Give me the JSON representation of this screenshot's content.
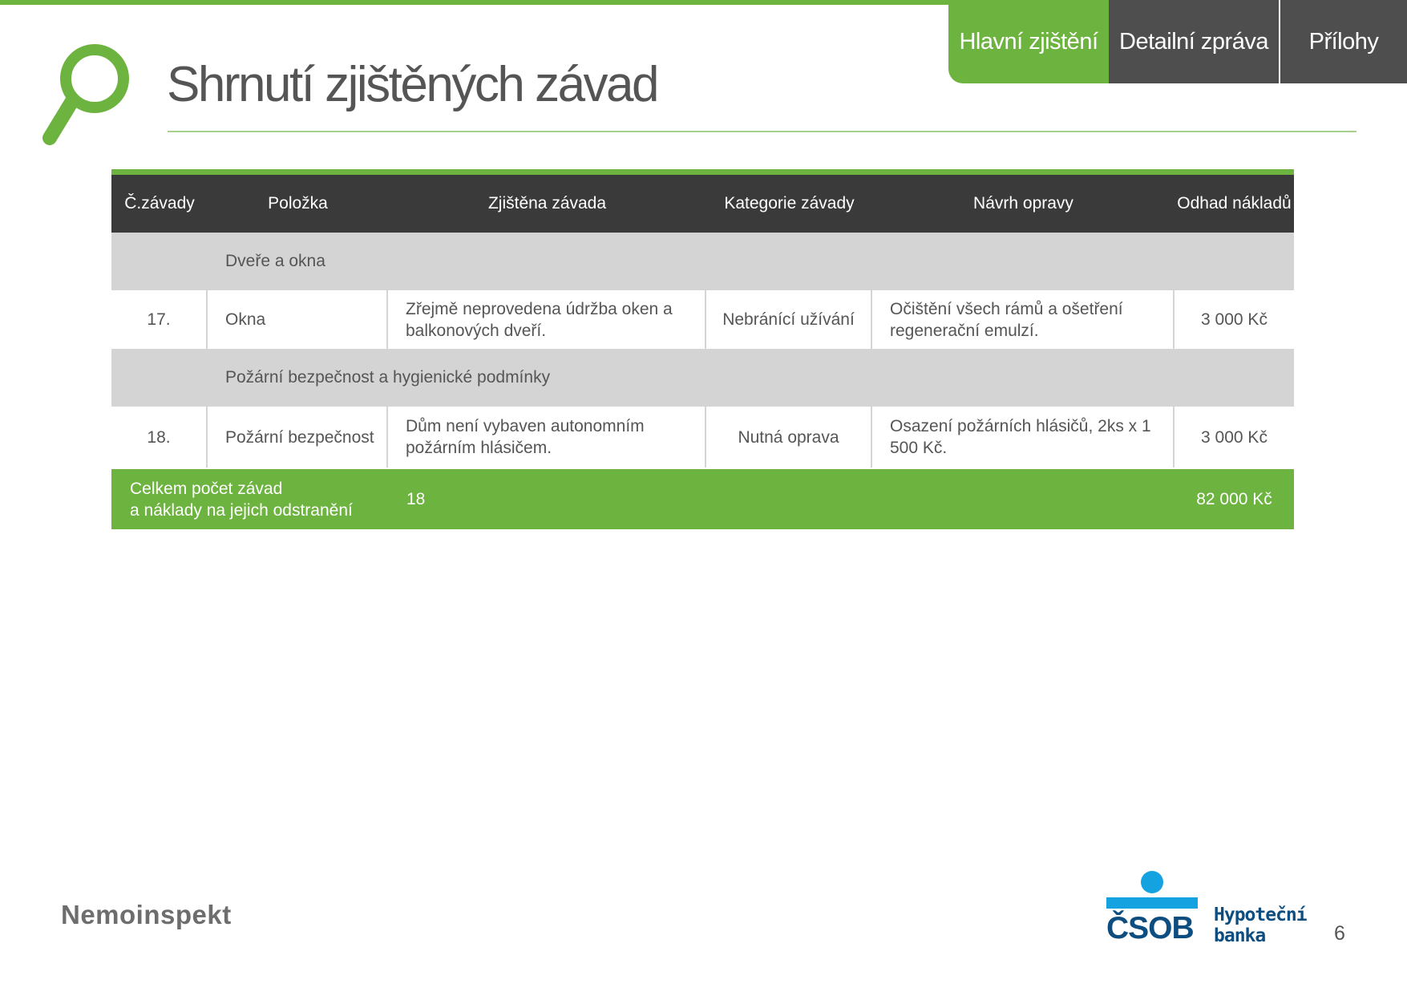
{
  "tabs": [
    {
      "label": "Hlavní zjištění",
      "active": true
    },
    {
      "label": "Detailní zpráva",
      "active": false
    },
    {
      "label": "Přílohy",
      "active": false
    }
  ],
  "title": "Shrnutí zjištěných závad",
  "table": {
    "headers": [
      "Č.závady",
      "Položka",
      "Zjištěna závada",
      "Kategorie závady",
      "Návrh opravy",
      "Odhad nákladů"
    ],
    "sections": [
      {
        "name": "Dveře a okna",
        "rows": [
          {
            "id": "17.",
            "item": "Okna",
            "defect": "Zřejmě neprovedena údržba oken a balkonových dveří.",
            "category": "Nebránící užívání",
            "repair": "Očištění všech rámů a ošetření regenerační emulzí.",
            "cost": "3 000 Kč"
          }
        ]
      },
      {
        "name": "Požární bezpečnost a hygienické podmínky",
        "rows": [
          {
            "id": "18.",
            "item": "Požární bezpečnost",
            "defect": "Dům není vybaven autonomním požárním hlásičem.",
            "category": "Nutná oprava",
            "repair": "Osazení požárních hlásičů, 2ks x 1 500 Kč.",
            "cost": "3 000 Kč"
          }
        ]
      }
    ],
    "total": {
      "label_line1": "Celkem počet závad",
      "label_line2": "a náklady na jejich odstranění",
      "count": "18",
      "cost": "82 000 Kč"
    }
  },
  "footer": {
    "company_logo_text": "Nemoinspekt",
    "partner_logo_text": "ČSOB",
    "partner_sub_line1": "Hypoteční",
    "partner_sub_line2": "banka",
    "page_number": "6"
  },
  "colors": {
    "accent": "#6db33f",
    "header_dark": "#3a3a3a",
    "tab_dark": "#4e4e4e",
    "csob_blue": "#0d4d80",
    "csob_light": "#14a3e0"
  }
}
